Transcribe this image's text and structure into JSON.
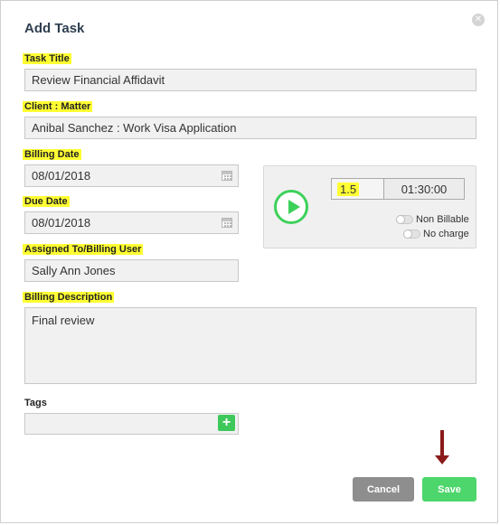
{
  "dialog": {
    "title": "Add Task",
    "close_icon": "close-icon"
  },
  "form": {
    "task_title": {
      "label": "Task Title",
      "value": "Review Financial Affidavit"
    },
    "client_matter": {
      "label": "Client : Matter",
      "value": "Anibal Sanchez : Work Visa Application"
    },
    "billing_date": {
      "label": "Billing Date",
      "value": "08/01/2018",
      "icon": "calendar-icon"
    },
    "due_date": {
      "label": "Due Date",
      "value": "08/01/2018",
      "icon": "calendar-icon"
    },
    "assigned_to": {
      "label": "Assigned To/Billing User",
      "value": "Sally Ann Jones"
    },
    "billing_description": {
      "label": "Billing Description",
      "value": "Final review"
    },
    "tags": {
      "label": "Tags",
      "value": "",
      "add_icon": "plus-icon"
    }
  },
  "timer": {
    "play_icon": "play-icon",
    "hours": "1.5",
    "clock": "01:30:00",
    "non_billable_label": "Non Billable",
    "no_charge_label": "No charge"
  },
  "actions": {
    "cancel_label": "Cancel",
    "save_label": "Save"
  },
  "colors": {
    "highlight": "#ffff33",
    "accent_green": "#3dd15a",
    "cancel_gray": "#8e8e8e",
    "save_green": "#4cd66b",
    "arrow_red": "#8b1a1a"
  }
}
